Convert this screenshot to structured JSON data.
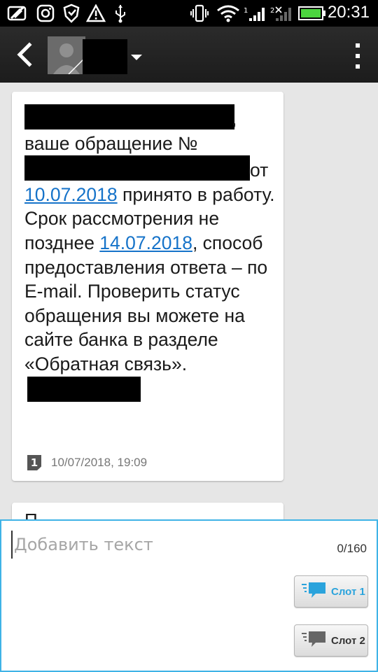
{
  "status_bar": {
    "time": "20:31",
    "icons_left": [
      "pencil-slash-icon",
      "instagram-icon",
      "shield-hand-icon",
      "warning-icon",
      "usb-icon"
    ],
    "icons_right": [
      "vibrate-icon",
      "wifi-icon",
      "signal-sim1-icon",
      "signal-sim2-icon",
      "battery-icon"
    ],
    "battery_color": "#4cd43f"
  },
  "action_bar": {
    "icons": [
      "back-arrow-icon",
      "contact-avatar-icon",
      "dropdown-triangle-icon",
      "overflow-menu-icon"
    ]
  },
  "message": {
    "line1": "ваше обращение №",
    "after_redact": "от",
    "date1": "10.07.2018",
    "text_after_date1": " принято в работу. Срок рассмотрения не позднее ",
    "date2": "14.07.2018",
    "text_after_date2": ", способ предоставления ответа – по E-mail. Проверить статус обращения вы можете на сайте банка в разделе «Обратная связь».",
    "sim_slot": "1",
    "timestamp": "10/07/2018, 19:09"
  },
  "message2": {
    "text": "П"
  },
  "compose": {
    "placeholder": "Добавить текст",
    "char_count": "0/160",
    "slot1_label": "Слот 1",
    "slot2_label": "Слот 2",
    "accent_color": "#3fb3e6"
  }
}
